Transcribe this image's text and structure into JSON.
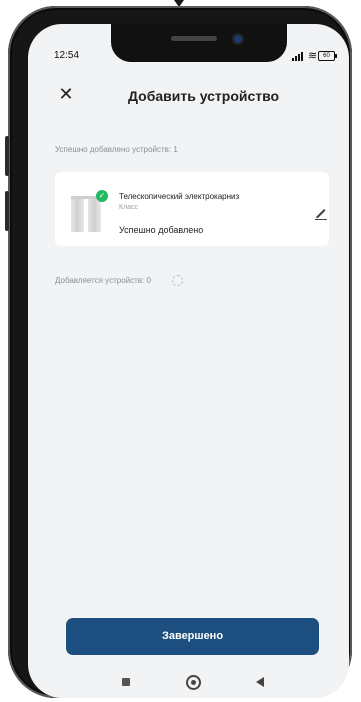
{
  "status_bar": {
    "time": "12:54",
    "battery": "60",
    "icons": [
      "signal-icon",
      "wifi-icon",
      "battery-icon"
    ]
  },
  "header": {
    "title": "Добавить устройство",
    "close_icon": "close-icon"
  },
  "added_count": "Успешно добавлено устройств: 1",
  "device": {
    "name": "Телескопический электрокарниз",
    "room": "Класс",
    "status": "Успешно добавлено",
    "check_mark": "✓",
    "status_color": "#1fba62"
  },
  "adding_count": "Добавляется устройств: 0",
  "done_button": "Завершено",
  "colors": {
    "accent": "#1c4f7f",
    "background": "#f2f3f5"
  },
  "nav": [
    "recent-apps-icon",
    "home-icon",
    "back-icon"
  ]
}
